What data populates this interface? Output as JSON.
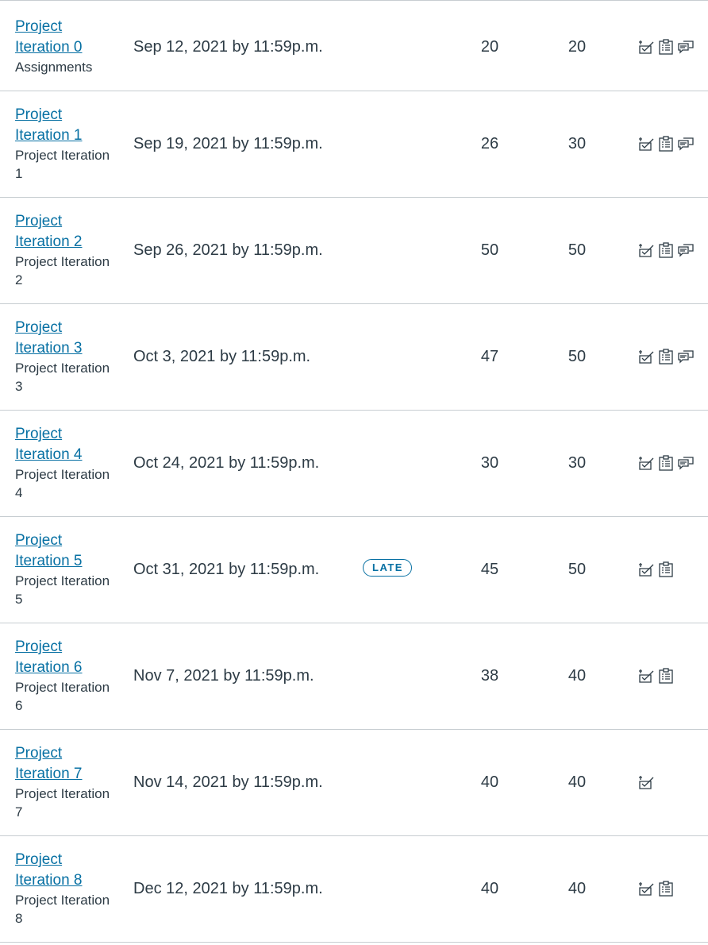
{
  "assignments": [
    {
      "title": "Project Iteration 0",
      "category": "Assignments",
      "due": "Sep 12, 2021 by 11:59p.m.",
      "status": "",
      "score": "20",
      "out_of": "20",
      "icons": [
        "rubric-icon",
        "submission-details-icon",
        "comments-icon"
      ]
    },
    {
      "title": "Project Iteration 1",
      "category": "Project Iteration 1",
      "due": "Sep 19, 2021 by 11:59p.m.",
      "status": "",
      "score": "26",
      "out_of": "30",
      "icons": [
        "rubric-icon",
        "submission-details-icon",
        "comments-icon"
      ]
    },
    {
      "title": "Project Iteration 2",
      "category": "Project Iteration 2",
      "due": "Sep 26, 2021 by 11:59p.m.",
      "status": "",
      "score": "50",
      "out_of": "50",
      "icons": [
        "rubric-icon",
        "submission-details-icon",
        "comments-icon"
      ]
    },
    {
      "title": "Project Iteration 3",
      "category": "Project Iteration 3",
      "due": "Oct 3, 2021 by 11:59p.m.",
      "status": "",
      "score": "47",
      "out_of": "50",
      "icons": [
        "rubric-icon",
        "submission-details-icon",
        "comments-icon"
      ]
    },
    {
      "title": "Project Iteration 4",
      "category": "Project Iteration 4",
      "due": "Oct 24, 2021 by 11:59p.m.",
      "status": "",
      "score": "30",
      "out_of": "30",
      "icons": [
        "rubric-icon",
        "submission-details-icon",
        "comments-icon"
      ]
    },
    {
      "title": "Project Iteration 5",
      "category": "Project Iteration 5",
      "due": "Oct 31, 2021 by 11:59p.m.",
      "status": "LATE",
      "score": "45",
      "out_of": "50",
      "icons": [
        "rubric-icon",
        "submission-details-icon"
      ]
    },
    {
      "title": "Project Iteration 6",
      "category": "Project Iteration 6",
      "due": "Nov 7, 2021 by 11:59p.m.",
      "status": "",
      "score": "38",
      "out_of": "40",
      "icons": [
        "rubric-icon",
        "submission-details-icon"
      ]
    },
    {
      "title": "Project Iteration 7",
      "category": "Project Iteration 7",
      "due": "Nov 14, 2021 by 11:59p.m.",
      "status": "",
      "score": "40",
      "out_of": "40",
      "icons": [
        "rubric-icon"
      ]
    },
    {
      "title": "Project Iteration 8",
      "category": "Project Iteration 8",
      "due": "Dec 12, 2021 by 11:59p.m.",
      "status": "",
      "score": "40",
      "out_of": "40",
      "icons": [
        "rubric-icon",
        "submission-details-icon"
      ]
    }
  ],
  "theme": {
    "link_color": "#0770a3",
    "text_color": "#2d3b45",
    "border_color": "#c7cdd1"
  }
}
